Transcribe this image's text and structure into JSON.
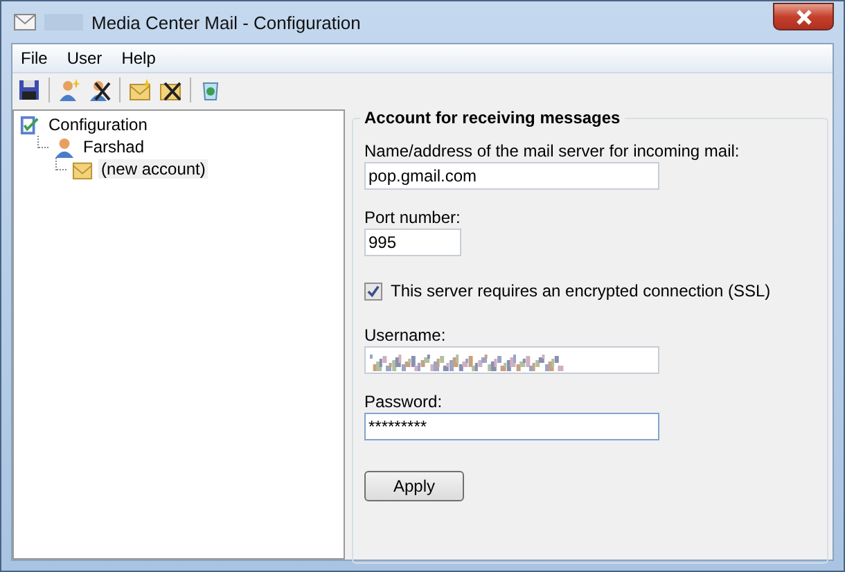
{
  "window": {
    "title": "Media Center Mail - Configuration"
  },
  "menu": [
    "File",
    "User",
    "Help"
  ],
  "toolbar": [
    {
      "kind": "save"
    },
    {
      "kind": "sep"
    },
    {
      "kind": "add-user"
    },
    {
      "kind": "remove-user"
    },
    {
      "kind": "sep"
    },
    {
      "kind": "add-account"
    },
    {
      "kind": "remove-account"
    },
    {
      "kind": "sep"
    },
    {
      "kind": "recycle"
    }
  ],
  "tree": [
    {
      "label": "Configuration",
      "kind": "config",
      "selected": false,
      "children": [
        {
          "label": "Farshad",
          "kind": "user",
          "selected": false,
          "children": [
            {
              "label": "(new account)",
              "kind": "account",
              "selected": true
            }
          ]
        }
      ]
    }
  ],
  "form": {
    "title": "Account for receiving messages",
    "server": {
      "label": "Name/address of the mail server for incoming mail:",
      "value": "pop.gmail.com"
    },
    "port": {
      "label": "Port number:",
      "value": "995"
    },
    "ssl": {
      "label": "This server requires an encrypted connection (SSL)",
      "checked": true
    },
    "username": {
      "label": "Username:",
      "obscured": true,
      "focused": false
    },
    "password": {
      "label": "Password:",
      "value": "*********",
      "focused": true
    },
    "apply": "Apply"
  }
}
